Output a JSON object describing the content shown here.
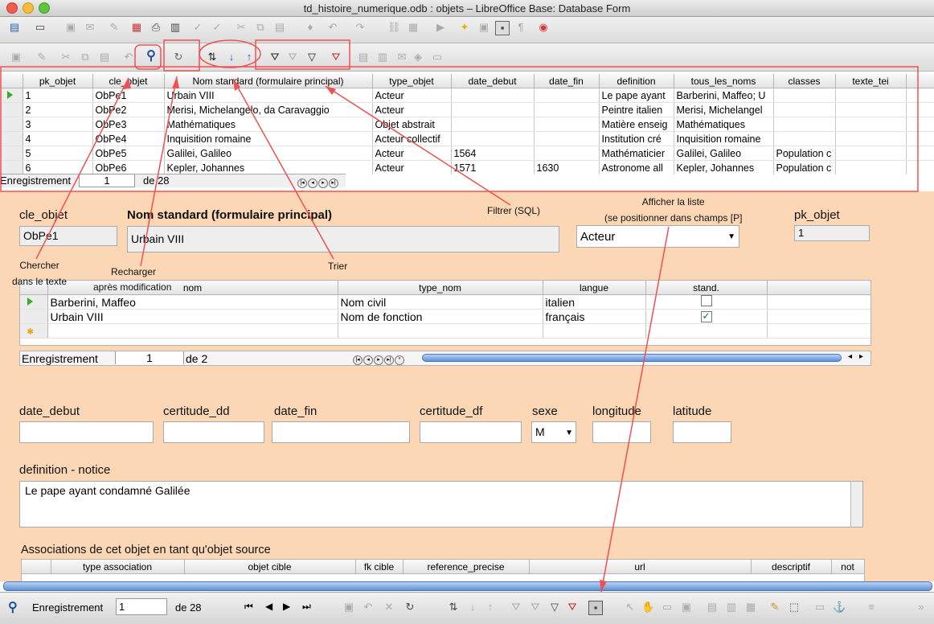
{
  "window": {
    "title": "td_histoire_numerique.odb : objets – LibreOffice Base: Database Form"
  },
  "colors": {
    "form_bg": "#fcd7b5",
    "annotation": "#f05050",
    "nav_green": "#3ea829"
  },
  "grid1": {
    "columns": [
      "pk_objet",
      "cle_objet",
      "Nom standard (formulaire principal)",
      "type_objet",
      "date_debut",
      "date_fin",
      "definition",
      "tous_les_noms",
      "classes",
      "texte_tei"
    ],
    "rows": [
      [
        "1",
        "ObPe1",
        "Urbain VIII",
        "Acteur",
        "",
        "",
        "Le pape ayant",
        "Barberini, Maffeo; U",
        ""
      ],
      [
        "2",
        "ObPe2",
        "Merisi, Michelangelo, da Caravaggio",
        "Acteur",
        "",
        "",
        "Peintre italien",
        "Merisi, Michelangel",
        ""
      ],
      [
        "3",
        "ObPe3",
        "Mathématiques",
        "Objet abstrait",
        "",
        "",
        "Matière enseig",
        "Mathématiques",
        ""
      ],
      [
        "4",
        "ObPe4",
        "Inquisition romaine",
        "Acteur collectif",
        "",
        "",
        "Institution cré",
        "Inquisition romaine",
        ""
      ],
      [
        "5",
        "ObPe5",
        "Galilei, Galileo",
        "Acteur",
        "1564",
        "",
        "Mathématicier",
        "Galilei, Galileo",
        "Population c"
      ],
      [
        "6",
        "ObPe6",
        "Kepler, Johannes",
        "Acteur",
        "1571",
        "1630",
        "Astronome all",
        "Kepler, Johannes",
        "Population c"
      ]
    ],
    "nav": {
      "label": "Enregistrement",
      "current": "1",
      "of": "de 28"
    }
  },
  "annotations": {
    "search": [
      "Chercher",
      "dans le texte"
    ],
    "reload": [
      "Recharger",
      "après modification"
    ],
    "sort": "Trier",
    "filter": "Filtrer (SQL)",
    "list": [
      "Afficher la liste",
      "(se positionner dans champs [P]"
    ]
  },
  "form": {
    "cle_objet": {
      "label": "cle_objet",
      "value": "ObPe1"
    },
    "nom_standard": {
      "label": "Nom standard (formulaire principal)",
      "value": "Urbain VIII"
    },
    "type_objet": {
      "value": "Acteur"
    },
    "pk_objet": {
      "label": "pk_objet",
      "value": "1"
    },
    "subgrid": {
      "columns": [
        "nom",
        "type_nom",
        "langue",
        "stand."
      ],
      "rows": [
        {
          "nom": "Barberini, Maffeo",
          "type_nom": "Nom civil",
          "langue": "italien",
          "stand": false
        },
        {
          "nom": "Urbain VIII",
          "type_nom": "Nom de fonction",
          "langue": "français",
          "stand": true
        }
      ],
      "nav": {
        "label": "Enregistrement",
        "current": "1",
        "of": "de 2"
      }
    },
    "fields": {
      "date_debut": "date_debut",
      "certitude_dd": "certitude_dd",
      "date_fin": "date_fin",
      "certitude_df": "certitude_df",
      "sexe": "sexe",
      "sexe_value": "M",
      "longitude": "longitude",
      "latitude": "latitude"
    },
    "definition": {
      "label": "definition - notice",
      "value": "Le pape ayant condamné Galilée"
    },
    "associations": {
      "title": "Associations de cet objet en tant qu'objet source",
      "columns": [
        "type association",
        "objet cible",
        "fk cible",
        "reference_precise",
        "url",
        "descriptif",
        "not"
      ]
    }
  },
  "bottom_nav": {
    "label": "Enregistrement",
    "current": "1",
    "of": "de 28"
  }
}
